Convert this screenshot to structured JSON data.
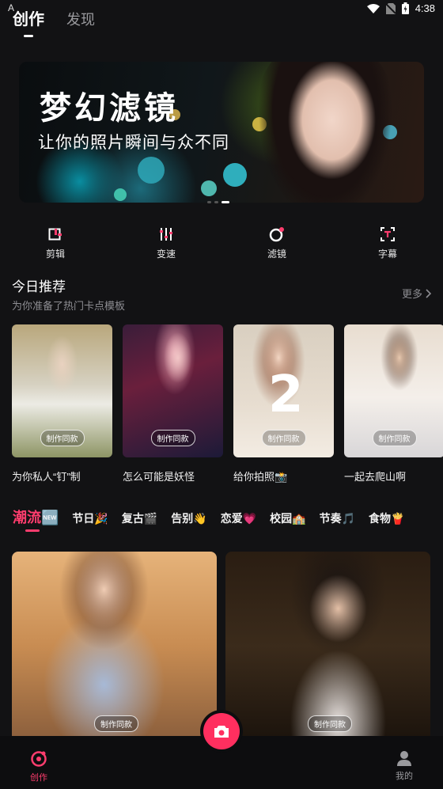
{
  "status_bar": {
    "time": "4:38",
    "left_glyph": "A"
  },
  "top_tabs": [
    {
      "label": "创作"
    },
    {
      "label": "发现"
    }
  ],
  "banner": {
    "title": "梦幻滤镜",
    "subtitle": "让你的照片瞬间与众不同"
  },
  "tools": [
    {
      "label": "剪辑",
      "icon": "clip-icon"
    },
    {
      "label": "变速",
      "icon": "speed-icon"
    },
    {
      "label": "滤镜",
      "icon": "filter-icon"
    },
    {
      "label": "字幕",
      "icon": "subtitle-icon"
    }
  ],
  "recommend": {
    "title": "今日推荐",
    "subtitle": "为你准备了热门卡点模板",
    "more": "更多",
    "badge": "制作同款",
    "cards": [
      {
        "name": "为你私人“钉”制"
      },
      {
        "name": "怎么可能是妖怪"
      },
      {
        "name": "给你拍照📸",
        "overlay": "2"
      },
      {
        "name": "一起去爬山啊"
      }
    ]
  },
  "categories": [
    {
      "label": "潮流🆕"
    },
    {
      "label": "节日🎉"
    },
    {
      "label": "复古🎬"
    },
    {
      "label": "告别👋"
    },
    {
      "label": "恋爱💗"
    },
    {
      "label": "校园🏫"
    },
    {
      "label": "节奏🎵"
    },
    {
      "label": "食物🍟"
    }
  ],
  "feed": {
    "badge": "制作同款"
  },
  "bottom_nav": {
    "create": "创作",
    "mine": "我的"
  },
  "colors": {
    "accent": "#ff3d6e",
    "background": "#121214"
  }
}
